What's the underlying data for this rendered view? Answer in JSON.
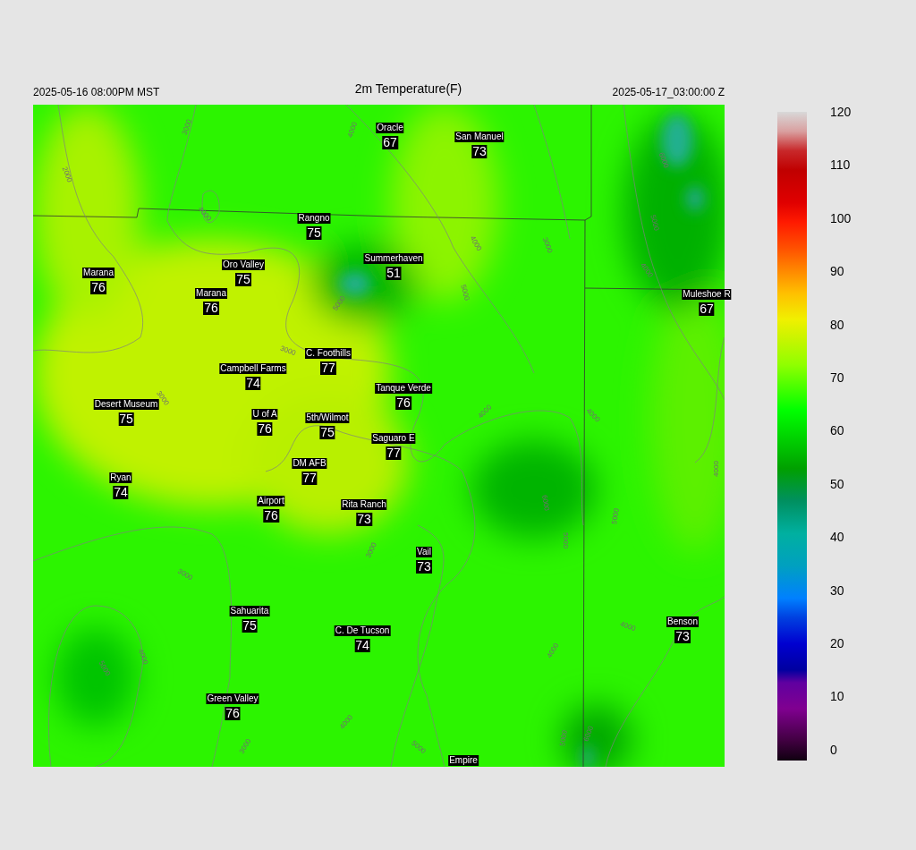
{
  "header": {
    "valid_local": "2025-05-16 08:00PM MST",
    "title": "2m Temperature(F)",
    "valid_utc": "2025-05-17_03:00:00 Z"
  },
  "stations": [
    {
      "name": "Oracle",
      "value": "67"
    },
    {
      "name": "San Manuel",
      "value": "73"
    },
    {
      "name": "Rangno",
      "value": "75"
    },
    {
      "name": "Summerhaven",
      "value": "51"
    },
    {
      "name": "Marana",
      "value": "76"
    },
    {
      "name": "Oro Valley",
      "value": "75"
    },
    {
      "name": "Marana",
      "value": "76"
    },
    {
      "name": "Muleshoe R",
      "value": "67"
    },
    {
      "name": "C. Foothills",
      "value": "77"
    },
    {
      "name": "Campbell Farms",
      "value": "74"
    },
    {
      "name": "Tanque Verde",
      "value": "76"
    },
    {
      "name": "Desert Museum",
      "value": "75"
    },
    {
      "name": "U of A",
      "value": "76"
    },
    {
      "name": "5th/Wilmot",
      "value": "75"
    },
    {
      "name": "Saguaro E",
      "value": "77"
    },
    {
      "name": "DM AFB",
      "value": "77"
    },
    {
      "name": "Ryan",
      "value": "74"
    },
    {
      "name": "Airport",
      "value": "76"
    },
    {
      "name": "Rita Ranch",
      "value": "73"
    },
    {
      "name": "Vail",
      "value": "73"
    },
    {
      "name": "Sahuarita",
      "value": "75"
    },
    {
      "name": "C. De Tucson",
      "value": "74"
    },
    {
      "name": "Benson",
      "value": "73"
    },
    {
      "name": "Green Valley",
      "value": "76"
    },
    {
      "name": "Empire"
    }
  ],
  "contour_labels": [
    "3000",
    "2000",
    "4000",
    "4000",
    "5000",
    "3000",
    "3000",
    "6000",
    "4000",
    "3000",
    "5000",
    "4000",
    "5000",
    "4000",
    "4000",
    "3000",
    "4000",
    "5000",
    "3000",
    "3000",
    "4000",
    "4000",
    "6000",
    "5000",
    "5000",
    "4000",
    "4000",
    "5000",
    "5000",
    "6000"
  ],
  "colorbar": {
    "ticks": [
      "120",
      "110",
      "100",
      "90",
      "80",
      "70",
      "60",
      "50",
      "40",
      "30",
      "20",
      "10",
      "0"
    ]
  }
}
